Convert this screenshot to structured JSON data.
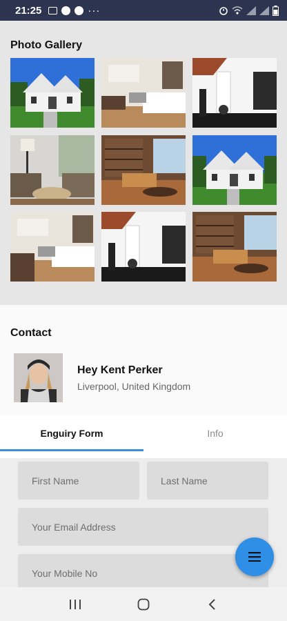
{
  "status_bar": {
    "time": "21:25",
    "more": "···",
    "left_icons": [
      "image-icon",
      "skype-icon",
      "b-icon"
    ],
    "right_icons": [
      "alarm-icon",
      "wifi-icon",
      "signal-icon",
      "signal-icon",
      "battery-icon"
    ]
  },
  "gallery": {
    "title": "Photo Gallery",
    "tiles": [
      "house-exterior",
      "kitchen",
      "living-room-white",
      "sitting-area",
      "library-living",
      "house-exterior",
      "kitchen",
      "living-room-white",
      "library-living"
    ]
  },
  "contact": {
    "title": "Contact",
    "name": "Hey Kent Perker",
    "location": "Liverpool, United Kingdom"
  },
  "tabs": {
    "enquiry": "Enguiry Form",
    "info": "Info"
  },
  "form": {
    "first_name_placeholder": "First Name",
    "last_name_placeholder": "Last Name",
    "email_placeholder": "Your Email Address",
    "mobile_placeholder": "Your Mobile No"
  },
  "colors": {
    "accent": "#3a8fe0",
    "fab": "#2f8ee6",
    "status_bar": "#2c3450"
  },
  "fab": {
    "icon": "menu-icon"
  },
  "navbar": {
    "icons": [
      "recents-icon",
      "home-icon",
      "back-icon"
    ]
  }
}
